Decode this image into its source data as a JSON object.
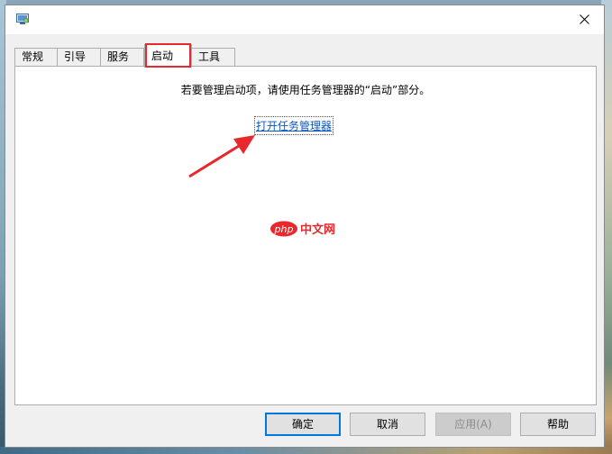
{
  "tabs": [
    {
      "label": "常规"
    },
    {
      "label": "引导"
    },
    {
      "label": "服务"
    },
    {
      "label": "启动"
    },
    {
      "label": "工具"
    }
  ],
  "startup": {
    "info_text": "若要管理启动项，请使用任务管理器的“启动”部分。",
    "link_text": "打开任务管理器"
  },
  "watermark": {
    "prefix": "php",
    "suffix": "中文网"
  },
  "buttons": {
    "ok": "确定",
    "cancel": "取消",
    "apply": "应用(A)",
    "help": "帮助"
  },
  "colors": {
    "highlight": "#e8282c",
    "link": "#0a56c4",
    "accent": "#0078d7"
  }
}
